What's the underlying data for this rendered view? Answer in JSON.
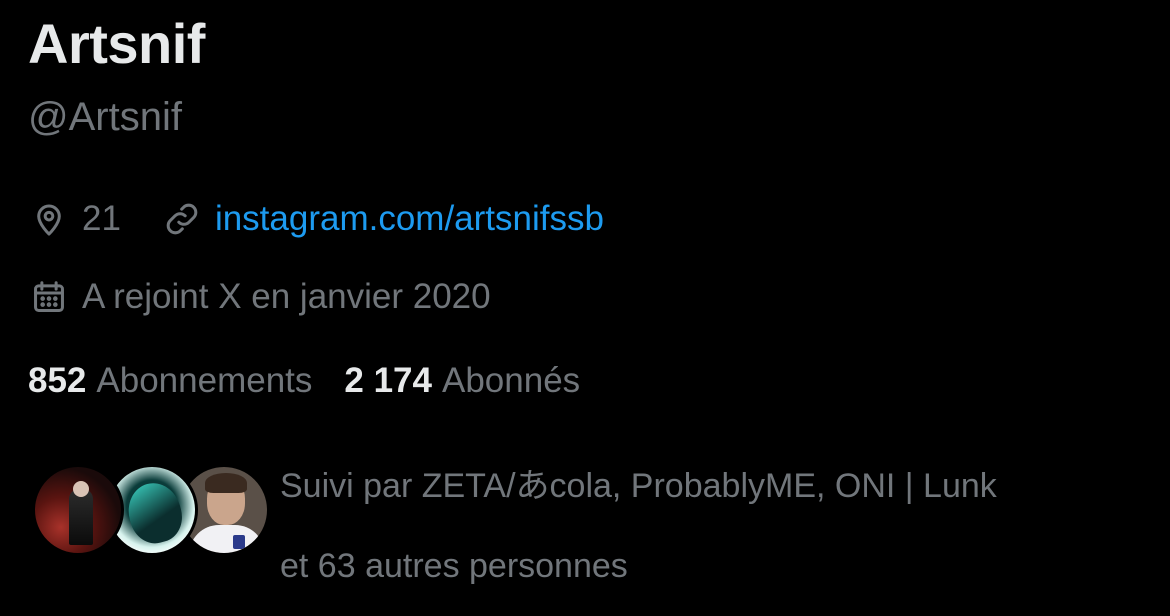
{
  "profile": {
    "display_name": "Artsnif",
    "handle": "@Artsnif",
    "location": "21",
    "website": "instagram.com/artsnifssb",
    "joined": "A rejoint X en janvier 2020"
  },
  "stats": {
    "following_count": "852",
    "following_label": "Abonnements",
    "followers_count": "2 174",
    "followers_label": "Abonnés"
  },
  "followed_by": {
    "line1": "Suivi par ZETA/あcola, ProbablyME, ONI | Lunk",
    "line2": "et 63 autres personnes"
  },
  "colors": {
    "background": "#000000",
    "primary_text": "#e7e9ea",
    "secondary_text": "#71767b",
    "link": "#1d9bf0"
  },
  "icons": {
    "location": "map-pin-icon",
    "website": "link-icon",
    "joined": "calendar-icon"
  }
}
